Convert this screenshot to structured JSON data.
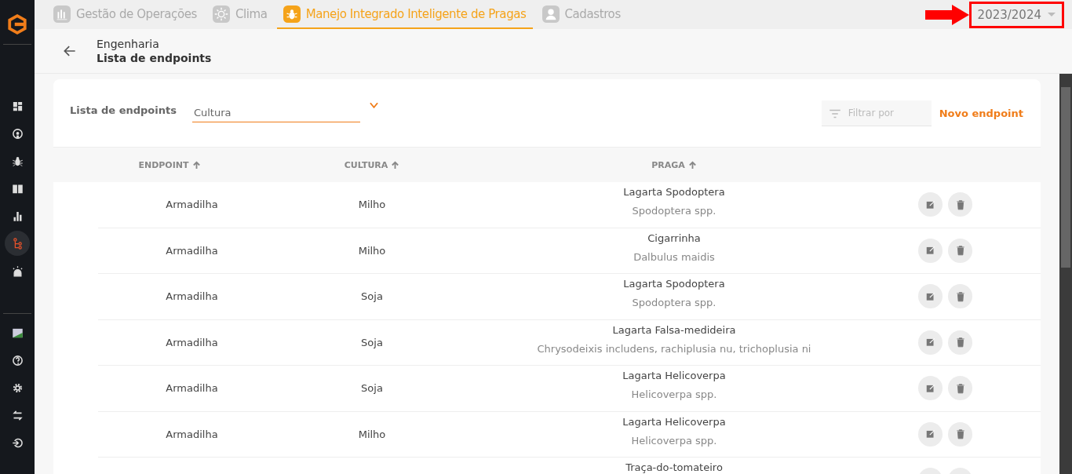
{
  "sidebar": {
    "items": [
      {
        "kind": "dashboard",
        "selected": false
      },
      {
        "kind": "signal",
        "selected": false
      },
      {
        "kind": "bug",
        "selected": false
      },
      {
        "kind": "book",
        "selected": false
      },
      {
        "kind": "chart",
        "selected": false
      },
      {
        "kind": "tree",
        "selected": true
      },
      {
        "kind": "alarm",
        "selected": false
      }
    ],
    "bottom_items": [
      {
        "kind": "image"
      },
      {
        "kind": "help"
      },
      {
        "kind": "settings"
      },
      {
        "kind": "swap"
      },
      {
        "kind": "logout"
      }
    ]
  },
  "tabs": [
    {
      "label": "Gestão de Operações",
      "kind": "operations",
      "selected": false
    },
    {
      "label": "Clima",
      "kind": "sun",
      "selected": false
    },
    {
      "label": "Manejo Integrado Inteligente de Pragas",
      "kind": "bug",
      "selected": true
    },
    {
      "label": "Cadastros",
      "kind": "user",
      "selected": false
    }
  ],
  "season_select": {
    "value": "2023/2024",
    "highlighted": true
  },
  "header": {
    "parent": "Engenharia",
    "title": "Lista de endpoints"
  },
  "toolbar": {
    "label": "Lista de endpoints",
    "culture_field": {
      "placeholder": "Cultura"
    },
    "filter": {
      "placeholder": "Filtrar por"
    },
    "new_button": "Novo endpoint"
  },
  "table": {
    "columns": [
      "ENDPOINT",
      "CULTURA",
      "PRAGA"
    ],
    "rows": [
      {
        "endpoint": "Armadilha",
        "cultura": "Milho",
        "praga": "Lagarta Spodoptera",
        "scientific": "Spodoptera spp."
      },
      {
        "endpoint": "Armadilha",
        "cultura": "Milho",
        "praga": "Cigarrinha",
        "scientific": "Dalbulus maidis"
      },
      {
        "endpoint": "Armadilha",
        "cultura": "Soja",
        "praga": "Lagarta Spodoptera",
        "scientific": "Spodoptera spp."
      },
      {
        "endpoint": "Armadilha",
        "cultura": "Soja",
        "praga": "Lagarta Falsa-medideira",
        "scientific": "Chrysodeixis includens, rachiplusia nu, trichoplusia ni"
      },
      {
        "endpoint": "Armadilha",
        "cultura": "Soja",
        "praga": "Lagarta Helicoverpa",
        "scientific": "Helicoverpa spp."
      },
      {
        "endpoint": "Armadilha",
        "cultura": "Milho",
        "praga": "Lagarta Helicoverpa",
        "scientific": "Helicoverpa spp."
      },
      {
        "praga": "Traça-do-tomateiro"
      }
    ]
  }
}
